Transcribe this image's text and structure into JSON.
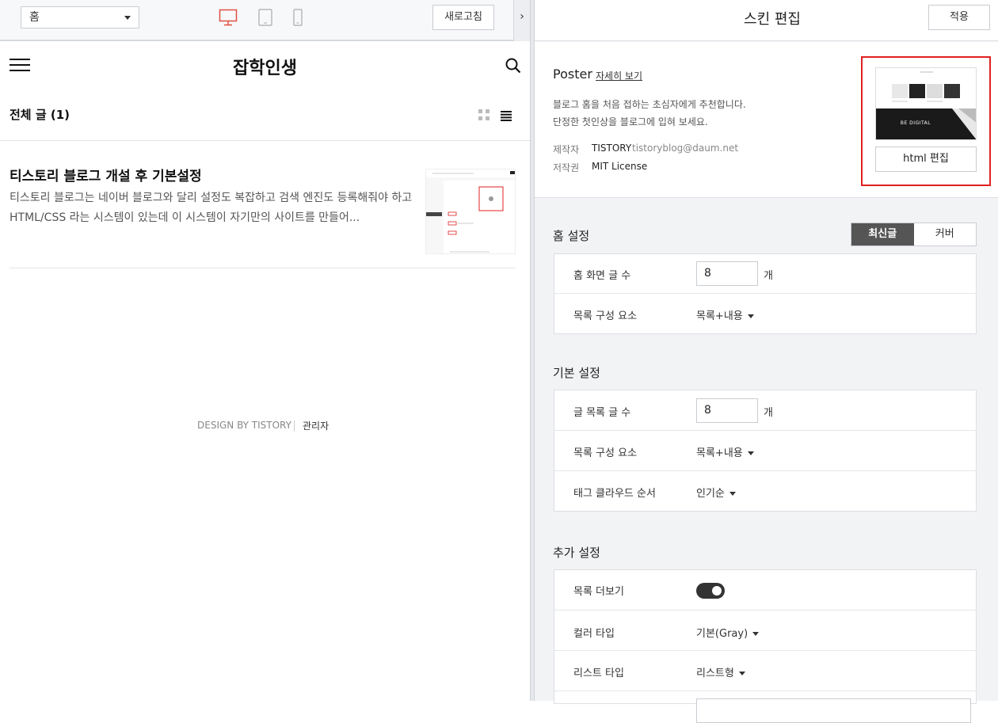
{
  "preview_toolbar": {
    "page_select": "홈",
    "refresh_label": "새로고침",
    "collapse_label": "›"
  },
  "blog": {
    "title": "잡학인생",
    "list_header": "전체 글 (1)",
    "post": {
      "title": "티스토리 블로그 개설 후 기본설정",
      "excerpt": "티스토리 블로그는 네이버 블로그와 달리 설정도 복잡하고 검색 엔진도 등록해줘야 하고 HTML/CSS 라는 시스템이 있는데 이 시스템이 자기만의 사이트를 만들어..."
    },
    "footer_design": "DESIGN BY TISTORY",
    "footer_admin": "관리자"
  },
  "editor": {
    "title": "스킨 편집",
    "apply_label": "적용",
    "skin": {
      "name": "Poster",
      "more_link": "자세히 보기",
      "desc_line1": "블로그 홈을 처음 접하는 초심자에게 추천합니다.",
      "desc_line2": "단정한 첫인상을 블로그에 입혀 보세요.",
      "maker_label": "제작자",
      "maker_value": "TISTORY",
      "maker_email": "tistoryblog@daum.net",
      "license_label": "저작권",
      "license_value": "MIT License",
      "preview_text": "BE DIGITAL",
      "html_edit_label": "html 편집"
    },
    "home": {
      "title": "홈 설정",
      "tab_latest": "최신글",
      "tab_cover": "커버",
      "post_count_label": "홈 화면 글 수",
      "post_count_value": "8",
      "unit": "개",
      "composition_label": "목록 구성 요소",
      "composition_value": "목록+내용"
    },
    "basic": {
      "title": "기본 설정",
      "list_count_label": "글 목록 글 수",
      "list_count_value": "8",
      "unit": "개",
      "composition_label": "목록 구성 요소",
      "composition_value": "목록+내용",
      "tag_order_label": "태그 클라우드 순서",
      "tag_order_value": "인기순"
    },
    "extra": {
      "title": "추가 설정",
      "more_label": "목록 더보기",
      "more_on": true,
      "color_label": "컬러 타입",
      "color_value": "기본(Gray)",
      "list_type_label": "리스트 타입",
      "list_type_value": "리스트형"
    }
  },
  "colors": {
    "highlight": "#e02020",
    "device_active": "#e05040",
    "segment_active": "#555555"
  }
}
